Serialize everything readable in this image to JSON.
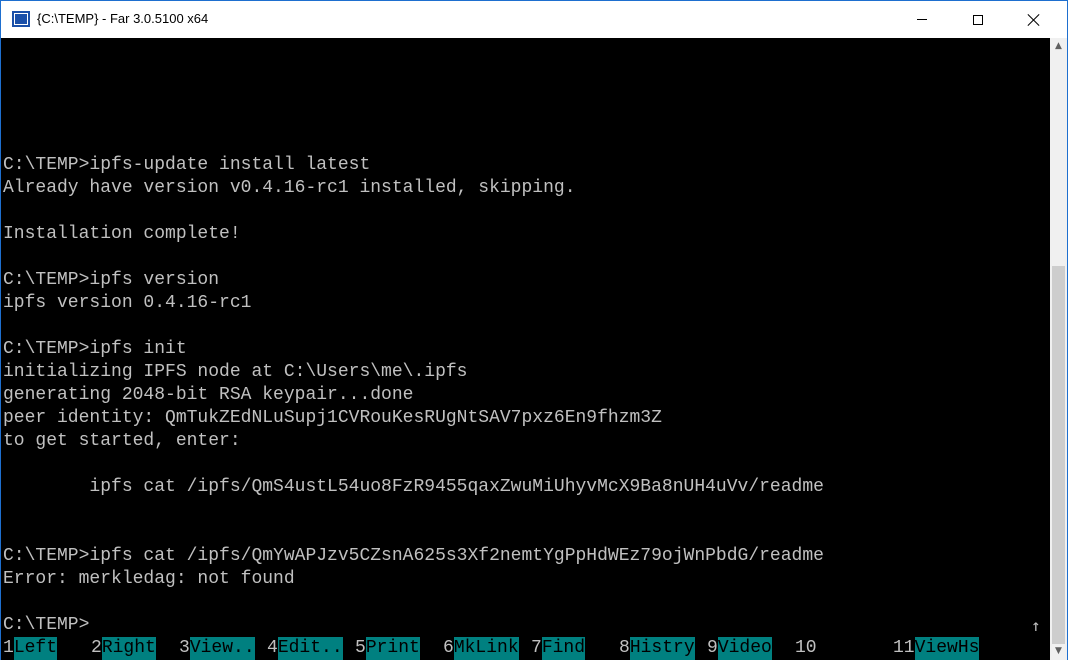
{
  "window": {
    "title": "{C:\\TEMP} - Far 3.0.5100 x64"
  },
  "console": {
    "lines": [
      "C:\\TEMP>ipfs-update install latest",
      "Already have version v0.4.16-rc1 installed, skipping.",
      "",
      "Installation complete!",
      "",
      "C:\\TEMP>ipfs version",
      "ipfs version 0.4.16-rc1",
      "",
      "C:\\TEMP>ipfs init",
      "initializing IPFS node at C:\\Users\\me\\.ipfs",
      "generating 2048-bit RSA keypair...done",
      "peer identity: QmTukZEdNLuSupj1CVRouKesRUgNtSAV7pxz6En9fhzm3Z",
      "to get started, enter:",
      "",
      "        ipfs cat /ipfs/QmS4ustL54uo8FzR9455qaxZwuMiUhyvMcX9Ba8nUH4uVv/readme",
      "",
      "",
      "C:\\TEMP>ipfs cat /ipfs/QmYwAPJzv5CZsnA625s3Xf2nemtYgPpHdWEz79ojWnPbdG/readme",
      "Error: merkledag: not found",
      "",
      "C:\\TEMP>"
    ],
    "scroll_arrow": "↑"
  },
  "keybar": {
    "keys": [
      {
        "num": "1",
        "label": "Left   "
      },
      {
        "num": "2",
        "label": "Right  "
      },
      {
        "num": "3",
        "label": "View.. "
      },
      {
        "num": "4",
        "label": "Edit.. "
      },
      {
        "num": "5",
        "label": "Print  "
      },
      {
        "num": "6",
        "label": "MkLink "
      },
      {
        "num": "7",
        "label": "Find   "
      },
      {
        "num": "8",
        "label": "Histry "
      },
      {
        "num": "9",
        "label": "Video  "
      },
      {
        "num": "10",
        "label": "      "
      },
      {
        "num": "11",
        "label": "ViewHs"
      },
      {
        "num": "",
        "label": "      "
      }
    ]
  },
  "colors": {
    "console_bg": "#000000",
    "console_fg": "#c0c0c0",
    "keybar_label_bg": "#008080"
  }
}
